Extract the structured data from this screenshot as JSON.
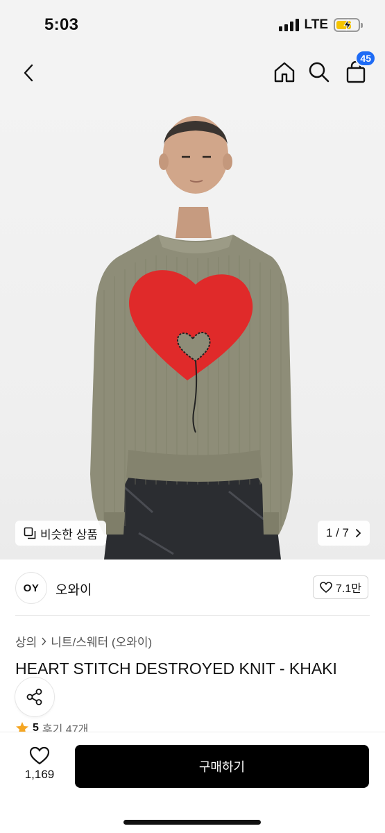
{
  "status_bar": {
    "time": "5:03",
    "network": "LTE"
  },
  "nav": {
    "cart_count": "45"
  },
  "hero": {
    "similar_label": "비슷한 상품",
    "pager": "1 / 7"
  },
  "brand": {
    "logo_text": "OY",
    "name": "오와이",
    "likes": "7.1만"
  },
  "breadcrumb": {
    "category": "상의",
    "subcategory": "니트/스웨터 (오와이)"
  },
  "product": {
    "title": "HEART STITCH DESTROYED KNIT - KHAKI",
    "rating": "5",
    "review_label": "후기 47개"
  },
  "bottom": {
    "wish_count": "1,169",
    "buy_label": "구매하기"
  },
  "colors": {
    "accent": "#1e6bf5",
    "sweater": "#8e8d78",
    "heart": "#e02a2a",
    "buy_button": "#000000"
  }
}
